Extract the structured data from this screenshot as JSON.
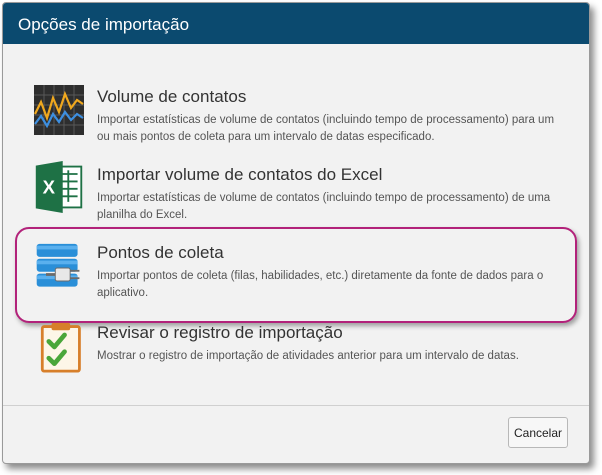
{
  "dialog": {
    "title": "Opções de importação",
    "options": [
      {
        "title": "Volume de contatos",
        "description": "Importar estatísticas de volume de contatos (incluindo tempo de processamento) para um ou mais pontos de coleta para um intervalo de datas especificado.",
        "icon": "chart-icon"
      },
      {
        "title": "Importar volume de contatos do Excel",
        "description": "Importar estatísticas de volume de contatos (incluindo tempo de processamento) de uma planilha do Excel.",
        "icon": "excel-icon"
      },
      {
        "title": "Pontos de coleta",
        "description": "Importar pontos de coleta (filas, habilidades, etc.) diretamente da fonte de dados para o aplicativo.",
        "icon": "database-plug-icon"
      },
      {
        "title": "Revisar o registro de importação",
        "description": "Mostrar o registro de importação de atividades anterior para um intervalo de datas.",
        "icon": "checklist-icon"
      }
    ],
    "cancel_label": "Cancelar"
  },
  "colors": {
    "titlebar": "#0b4a6f",
    "highlight": "#b2227a",
    "excel_green": "#1e7145",
    "database_blue": "#2a8fd8",
    "check_green": "#4aa63a",
    "clipboard_orange": "#d77f2a"
  }
}
